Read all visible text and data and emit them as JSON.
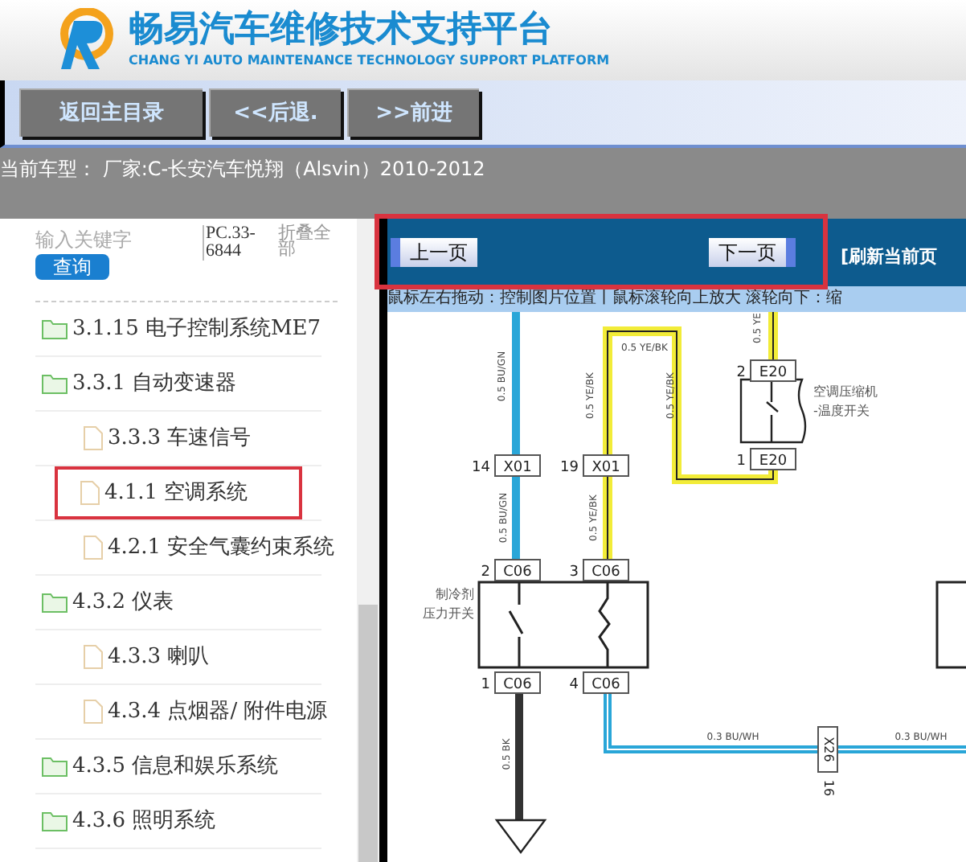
{
  "header": {
    "title": "畅易汽车维修技术支持平台",
    "subtitle": "CHANG YI AUTO MAINTENANCE TECHNOLOGY SUPPORT PLATFORM"
  },
  "nav_buttons": [
    "返回主目录",
    "<<后退.",
    ">>前进"
  ],
  "current_model": "当前车型：  厂家:C-长安汽车悦翔（Alsvin）2010-2012",
  "sidebar": {
    "search": {
      "placeholder": "输入关键字"
    },
    "search_button": "查询",
    "code": "PC.33-6844",
    "collapse_all": "折叠全部",
    "items": [
      {
        "kind": "folder",
        "label": "3.1.15 电子控制系统ME7",
        "highlighted": false
      },
      {
        "kind": "folder",
        "label": "3.3.1 自动变速器",
        "highlighted": false,
        "children": [
          {
            "kind": "document",
            "label": "3.3.3 车速信号",
            "highlighted": false
          },
          {
            "kind": "document",
            "label": "4.1.1 空调系统",
            "highlighted": true
          },
          {
            "kind": "document",
            "label": "4.2.1 安全气囊约束系统",
            "highlighted": false
          }
        ]
      },
      {
        "kind": "folder",
        "label": "4.3.2 仪表",
        "highlighted": false,
        "children": [
          {
            "kind": "document",
            "label": "4.3.3 喇叭",
            "highlighted": false
          },
          {
            "kind": "document",
            "label": "4.3.4 点烟器/ 附件电源",
            "highlighted": false
          }
        ]
      },
      {
        "kind": "folder",
        "label": "4.3.5 信息和娱乐系统",
        "highlighted": false
      },
      {
        "kind": "folder",
        "label": "4.3.6 照明系统",
        "highlighted": false
      }
    ]
  },
  "viewer": {
    "highlighted": true,
    "prev_button": "上一页",
    "next_button": "下一页",
    "refresh": "[刷新当前页",
    "hint": "鼠标左右拖动：控制图片位置丨鼠标滚轮向上放大  滚轮向下：缩",
    "diagram": {
      "connectors": [
        {
          "pin": "14",
          "name": "X01"
        },
        {
          "pin": "19",
          "name": "X01"
        },
        {
          "pin": "2",
          "name": "E20"
        },
        {
          "pin": "1",
          "name": "E20"
        },
        {
          "pin": "2",
          "name": "C06"
        },
        {
          "pin": "3",
          "name": "C06"
        },
        {
          "pin": "1",
          "name": "C06"
        },
        {
          "pin": "4",
          "name": "C06"
        },
        {
          "pin": "16",
          "name": "X26"
        }
      ],
      "wire_labels": [
        "0.5 BU/GN",
        "0.5 YE/BK",
        "0.5 YE/BK",
        "0.5 YE/BK",
        "0.5 YE",
        "0.5 BU/GN",
        "0.5 YE/BK",
        "0.5 BK",
        "0.3 BU/WH",
        "0.3 BU/WH"
      ],
      "components": [
        {
          "lines": [
            "空调压缩机",
            "-温度开关"
          ],
          "closed": false
        },
        {
          "lines": [
            "制冷剂",
            "压力开关"
          ],
          "closed": false
        }
      ]
    }
  }
}
